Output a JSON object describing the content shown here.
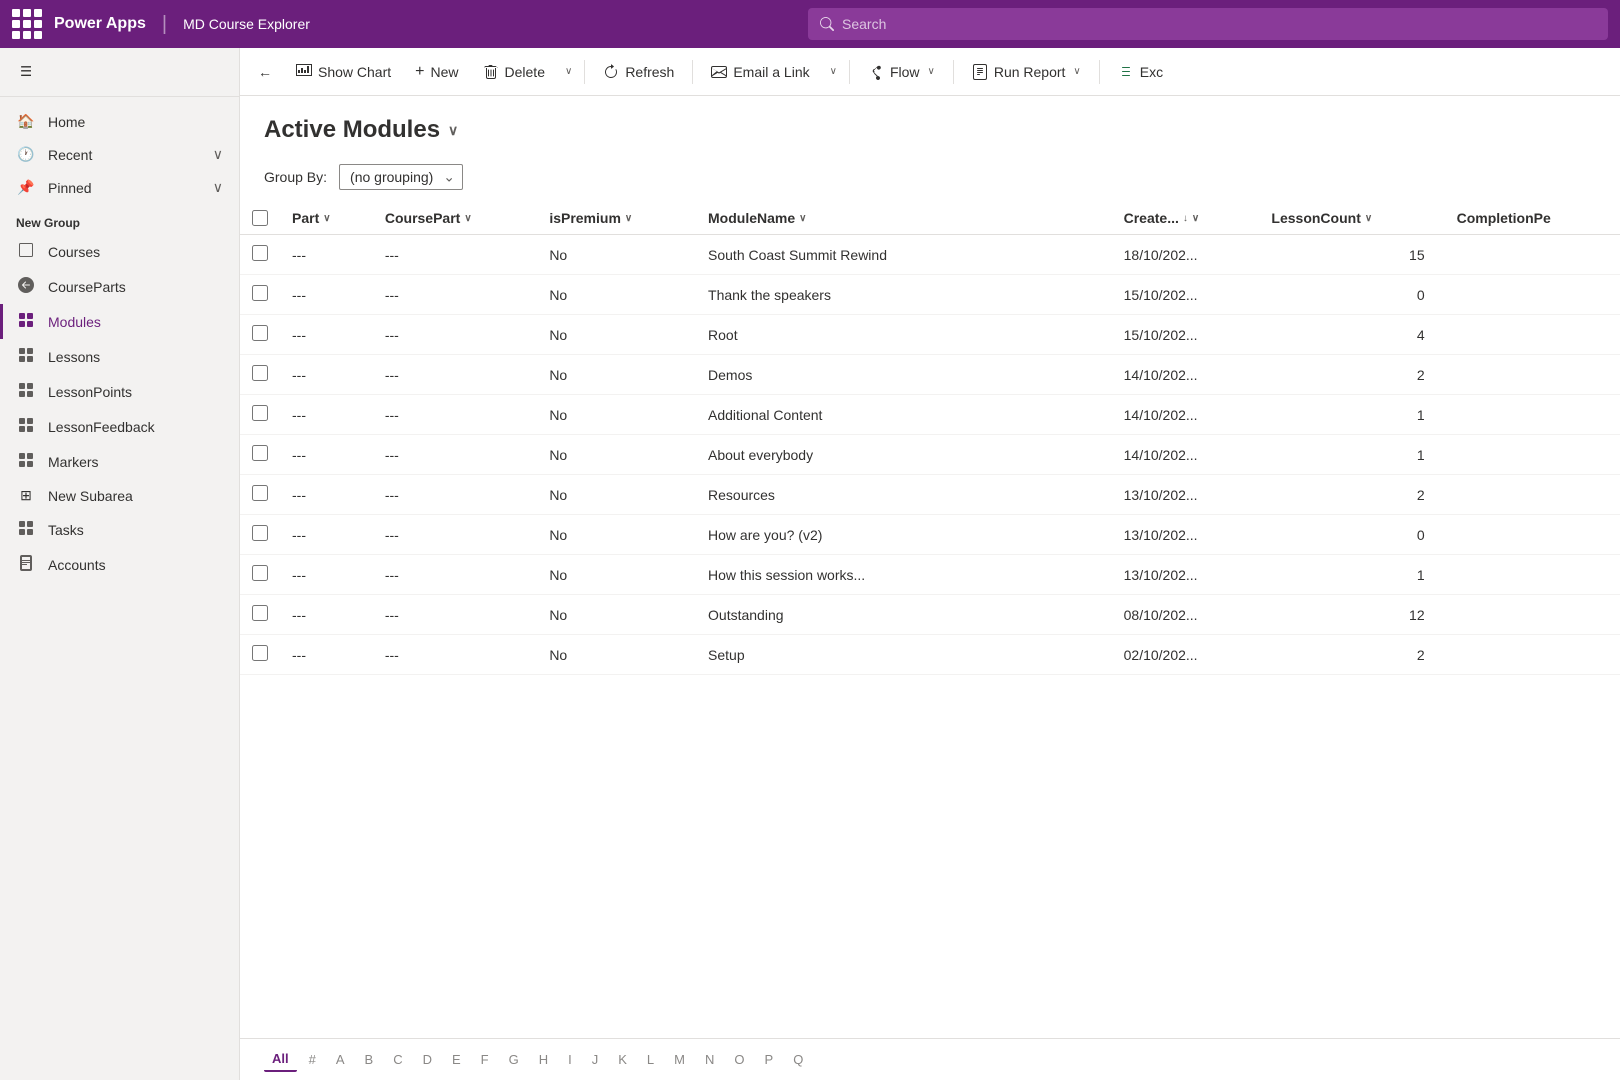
{
  "topNav": {
    "appTitle": "Power Apps",
    "divider": "|",
    "appName": "MD Course Explorer",
    "searchPlaceholder": "Search"
  },
  "sidebar": {
    "hamburgerLabel": "☰",
    "navItems": [
      {
        "id": "home",
        "icon": "🏠",
        "label": "Home",
        "hasChevron": false
      },
      {
        "id": "recent",
        "icon": "🕐",
        "label": "Recent",
        "hasChevron": true
      },
      {
        "id": "pinned",
        "icon": "📌",
        "label": "Pinned",
        "hasChevron": true
      }
    ],
    "groupLabel": "New Group",
    "groupItems": [
      {
        "id": "courses",
        "icon": "📚",
        "label": "Courses",
        "active": false
      },
      {
        "id": "courseparts",
        "icon": "🧩",
        "label": "CourseParts",
        "active": false
      },
      {
        "id": "modules",
        "icon": "🧩",
        "label": "Modules",
        "active": true
      },
      {
        "id": "lessons",
        "icon": "🧩",
        "label": "Lessons",
        "active": false
      },
      {
        "id": "lessonpoints",
        "icon": "🧩",
        "label": "LessonPoints",
        "active": false
      },
      {
        "id": "lessonfeedback",
        "icon": "🧩",
        "label": "LessonFeedback",
        "active": false
      },
      {
        "id": "markers",
        "icon": "🧩",
        "label": "Markers",
        "active": false
      },
      {
        "id": "newsubarea",
        "icon": "⊞",
        "label": "New Subarea",
        "active": false
      },
      {
        "id": "tasks",
        "icon": "🧩",
        "label": "Tasks",
        "active": false
      },
      {
        "id": "accounts",
        "icon": "🧾",
        "label": "Accounts",
        "active": false
      }
    ]
  },
  "commandBar": {
    "backLabel": "←",
    "showChartLabel": "Show Chart",
    "newLabel": "New",
    "deleteLabel": "Delete",
    "refreshLabel": "Refresh",
    "emailLinkLabel": "Email a Link",
    "flowLabel": "Flow",
    "runReportLabel": "Run Report",
    "excelLabel": "Exc"
  },
  "pageHeader": {
    "title": "Active Modules"
  },
  "groupBy": {
    "label": "Group By:",
    "value": "(no grouping)"
  },
  "columns": [
    {
      "id": "check",
      "label": "✓"
    },
    {
      "id": "part",
      "label": "Part",
      "sortable": true
    },
    {
      "id": "coursepart",
      "label": "CoursePart",
      "sortable": true
    },
    {
      "id": "ispremium",
      "label": "isPremium",
      "sortable": true
    },
    {
      "id": "modulename",
      "label": "ModuleName",
      "sortable": true
    },
    {
      "id": "created",
      "label": "Create...",
      "sortable": true,
      "sorted": "desc"
    },
    {
      "id": "lessoncount",
      "label": "LessonCount",
      "sortable": true
    },
    {
      "id": "completionpe",
      "label": "CompletionPe",
      "sortable": false
    }
  ],
  "rows": [
    {
      "part": "---",
      "coursepart": "---",
      "ispremium": "No",
      "modulename": "South Coast Summit Rewind",
      "created": "18/10/202...",
      "lessoncount": 15,
      "completionpe": ""
    },
    {
      "part": "---",
      "coursepart": "---",
      "ispremium": "No",
      "modulename": "Thank the speakers",
      "created": "15/10/202...",
      "lessoncount": 0,
      "completionpe": ""
    },
    {
      "part": "---",
      "coursepart": "---",
      "ispremium": "No",
      "modulename": "Root",
      "created": "15/10/202...",
      "lessoncount": 4,
      "completionpe": ""
    },
    {
      "part": "---",
      "coursepart": "---",
      "ispremium": "No",
      "modulename": "Demos",
      "created": "14/10/202...",
      "lessoncount": 2,
      "completionpe": ""
    },
    {
      "part": "---",
      "coursepart": "---",
      "ispremium": "No",
      "modulename": "Additional Content",
      "created": "14/10/202...",
      "lessoncount": 1,
      "completionpe": ""
    },
    {
      "part": "---",
      "coursepart": "---",
      "ispremium": "No",
      "modulename": "About everybody",
      "created": "14/10/202...",
      "lessoncount": 1,
      "completionpe": ""
    },
    {
      "part": "---",
      "coursepart": "---",
      "ispremium": "No",
      "modulename": "Resources",
      "created": "13/10/202...",
      "lessoncount": 2,
      "completionpe": ""
    },
    {
      "part": "---",
      "coursepart": "---",
      "ispremium": "No",
      "modulename": "How are you? (v2)",
      "created": "13/10/202...",
      "lessoncount": 0,
      "completionpe": ""
    },
    {
      "part": "---",
      "coursepart": "---",
      "ispremium": "No",
      "modulename": "How this session works...",
      "created": "13/10/202...",
      "lessoncount": 1,
      "completionpe": ""
    },
    {
      "part": "---",
      "coursepart": "---",
      "ispremium": "No",
      "modulename": "Outstanding",
      "created": "08/10/202...",
      "lessoncount": 12,
      "completionpe": ""
    },
    {
      "part": "---",
      "coursepart": "---",
      "ispremium": "No",
      "modulename": "Setup",
      "created": "02/10/202...",
      "lessoncount": 2,
      "completionpe": ""
    }
  ],
  "pagination": {
    "letters": [
      "All",
      "#",
      "A",
      "B",
      "C",
      "D",
      "E",
      "F",
      "G",
      "H",
      "I",
      "J",
      "K",
      "L",
      "M",
      "N",
      "O",
      "P",
      "Q"
    ],
    "active": "All"
  }
}
